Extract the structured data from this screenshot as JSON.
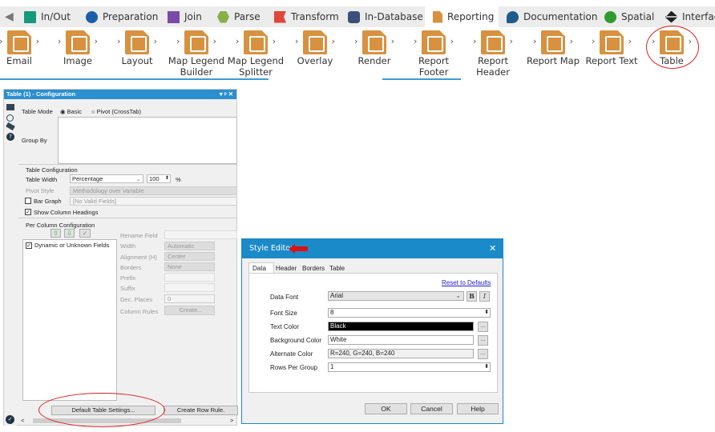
{
  "categories": [
    {
      "label": "In/Out",
      "color": "#16987d"
    },
    {
      "label": "Preparation",
      "color": "#1c5ea8"
    },
    {
      "label": "Join",
      "color": "#7b4aa8"
    },
    {
      "label": "Parse",
      "color": "#86b04a"
    },
    {
      "label": "Transform",
      "color": "#e0463c"
    },
    {
      "label": "In-Database",
      "color": "#3b4f7a"
    },
    {
      "label": "Reporting",
      "color": "#d8913f"
    },
    {
      "label": "Documentation",
      "color": "#1d5d8e"
    },
    {
      "label": "Spatial",
      "color": "#2f9a2f"
    },
    {
      "label": "Interface",
      "color": "#222222"
    }
  ],
  "tools": [
    {
      "label": "Email"
    },
    {
      "label": "Image"
    },
    {
      "label": "Layout"
    },
    {
      "label": "Map Legend Builder"
    },
    {
      "label": "Map Legend Splitter"
    },
    {
      "label": "Overlay"
    },
    {
      "label": "Render"
    },
    {
      "label": "Report Footer"
    },
    {
      "label": "Report Header"
    },
    {
      "label": "Report Map"
    },
    {
      "label": "Report Text"
    },
    {
      "label": "Table"
    }
  ],
  "config": {
    "title": "Table (1) - Configuration",
    "header_controls": "▾ ᵖ ✕",
    "table_mode_label": "Table Mode",
    "mode_basic": "Basic",
    "mode_pivot": "Pivot (CrossTab)",
    "group_by_label": "Group By",
    "table_configuration": "Table Configuration",
    "table_width_label": "Table Width",
    "table_width_value": "Percentage",
    "table_width_number": "100",
    "percent_sign": "%",
    "pivot_style_label": "Pivot Style",
    "pivot_style_value": "Methodology over Variable",
    "bar_graph_label": "Bar Graph",
    "bar_graph_value": "[No Valid Fields]",
    "show_column_headings": "Show Column Headings",
    "per_column_configuration": "Per Column Configuration",
    "field_item": "Dynamic or Unknown Fields",
    "rename_field": "Rename Field",
    "width_label": "Width",
    "width_value": "Automatic",
    "alignment_label": "Alignment (H)",
    "alignment_value": "Center",
    "borders_label": "Borders",
    "borders_value": "None",
    "prefix_label": "Prefix",
    "suffix_label": "Suffix",
    "dec_places_label": "Dec. Places",
    "dec_places_value": "0",
    "column_rules_label": "Column Rules",
    "create_button": "Create...",
    "default_table_settings": "Default Table Settings...",
    "create_row_rule": "Create Row Rule."
  },
  "style_editor": {
    "title": "Style Editor",
    "tabs": [
      "Data",
      "Header",
      "Borders",
      "Table"
    ],
    "reset": "Reset to Defaults",
    "data_font_label": "Data Font",
    "data_font_value": "Arial",
    "bold": "B",
    "italic": "I",
    "font_size_label": "Font Size",
    "font_size_value": "8",
    "text_color_label": "Text Color",
    "text_color_value": "Black",
    "bg_color_label": "Background Color",
    "bg_color_value": "White",
    "alt_color_label": "Alternate Color",
    "alt_color_value": "R=240, G=240, B=240",
    "rows_per_group_label": "Rows Per Group",
    "rows_per_group_value": "1",
    "ellipsis": "...",
    "ok": "OK",
    "cancel": "Cancel",
    "help": "Help"
  }
}
